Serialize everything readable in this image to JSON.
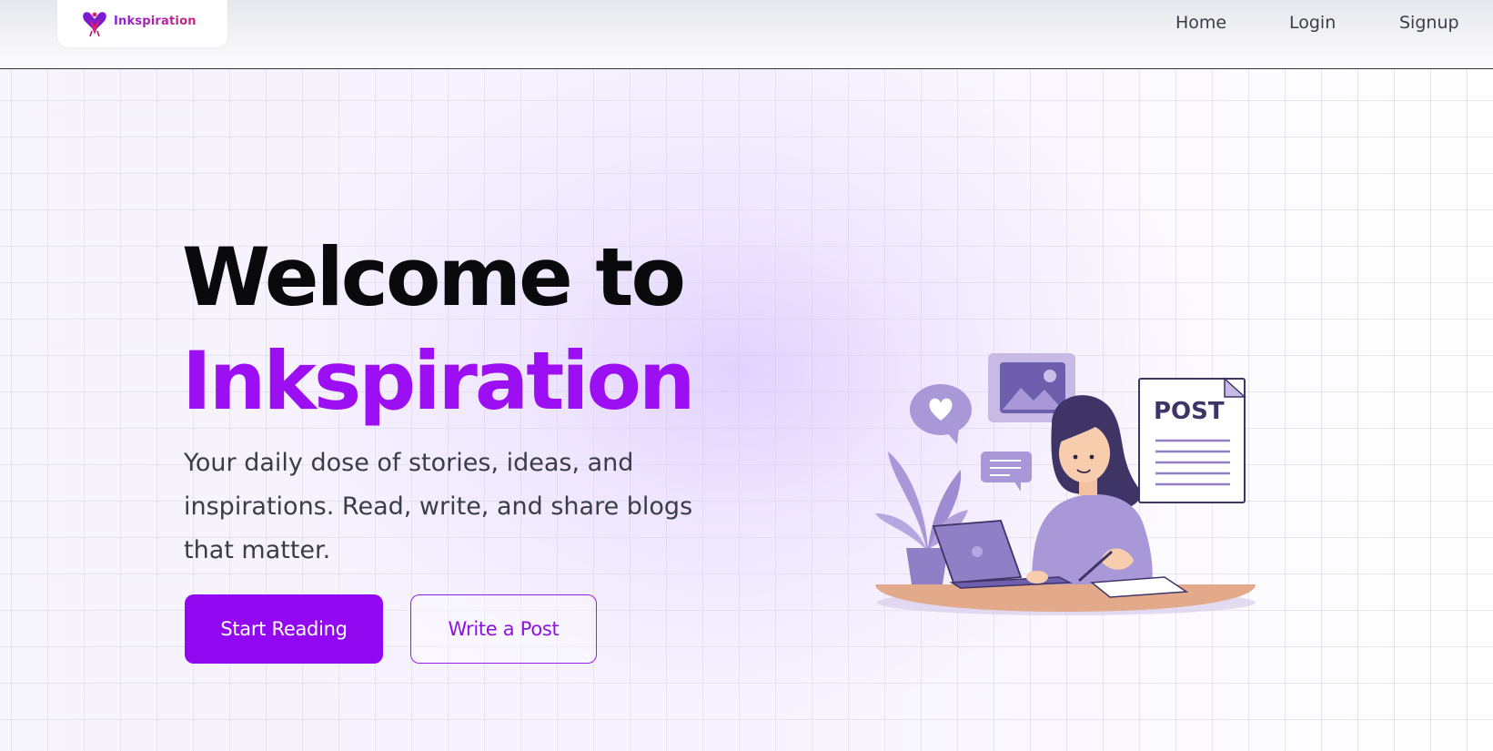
{
  "header": {
    "logo_text": "Inkspiration",
    "nav": [
      {
        "label": "Home"
      },
      {
        "label": "Login"
      },
      {
        "label": "Signup"
      }
    ]
  },
  "hero": {
    "title_line1": "Welcome to",
    "title_line2": "Inkspiration",
    "subtitle": "Your daily dose of stories, ideas, and inspirations. Read, write, and share blogs that matter.",
    "primary_button": "Start Reading",
    "secondary_button": "Write a Post",
    "illustration": {
      "post_label": "POST"
    }
  },
  "colors": {
    "brand_purple": "#9208f0",
    "title_dark": "#0a0a0c",
    "text_gray": "#3a3d47",
    "illustration_lavender": "#a898d8"
  }
}
